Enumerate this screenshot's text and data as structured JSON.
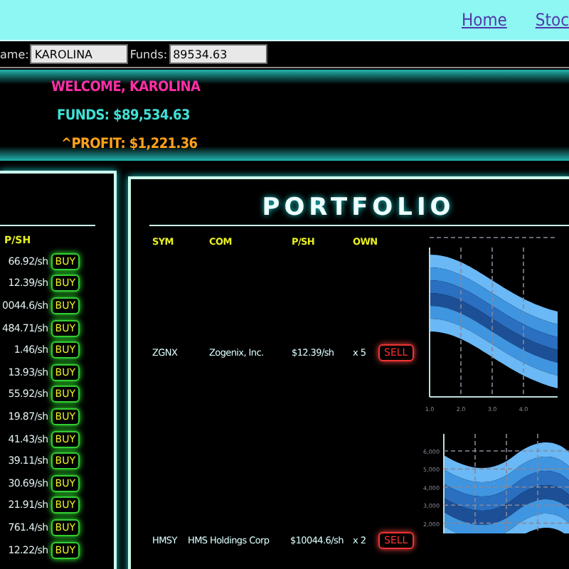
{
  "nav": {
    "links": [
      {
        "label": "Home"
      },
      {
        "label": "Stoc"
      }
    ]
  },
  "form": {
    "name_label": "ame:",
    "name_value": "KAROLINA",
    "funds_label": "Funds:",
    "funds_value": "89534.63"
  },
  "header": {
    "welcome": "WELCOME, KAROLINA",
    "funds": "FUNDS: $89,534.63",
    "profit": "^PROFIT: $1,221.36"
  },
  "market": {
    "column": "P/SH",
    "rows": [
      {
        "price": "66.92/sh",
        "button": "BUY"
      },
      {
        "price": "12.39/sh",
        "button": "BUY"
      },
      {
        "price": "0044.6/sh",
        "button": "BUY"
      },
      {
        "price": "484.71/sh",
        "button": "BUY"
      },
      {
        "price": "1.46/sh",
        "button": "BUY"
      },
      {
        "price": "13.93/sh",
        "button": "BUY"
      },
      {
        "price": "55.92/sh",
        "button": "BUY"
      },
      {
        "price": "19.87/sh",
        "button": "BUY"
      },
      {
        "price": "41.43/sh",
        "button": "BUY"
      },
      {
        "price": "39.11/sh",
        "button": "BUY"
      },
      {
        "price": "30.69/sh",
        "button": "BUY"
      },
      {
        "price": "21.91/sh",
        "button": "BUY"
      },
      {
        "price": "761.4/sh",
        "button": "BUY"
      },
      {
        "price": "12.22/sh",
        "button": "BUY"
      }
    ]
  },
  "portfolio": {
    "title": "PORTFOLIO",
    "columns": [
      "SYM",
      "COM",
      "P/SH",
      "OWN"
    ],
    "rows": [
      {
        "sym": "ZGNX",
        "company": "Zogenix, Inc.",
        "price": "$12.39/sh",
        "own": "x 5",
        "button": "SELL"
      },
      {
        "sym": "HMSY",
        "company": "HMS Holdings Corp",
        "price": "$10044.6/sh",
        "own": "x 2",
        "button": "SELL"
      }
    ],
    "chart_1": {
      "x_tick_labels": [
        "1.0",
        "2.0",
        "3.0",
        "4.0"
      ]
    },
    "chart_2": {
      "y_tick_labels": [
        "6,000",
        "5,000",
        "4,000",
        "3,000",
        "2,000"
      ]
    }
  }
}
